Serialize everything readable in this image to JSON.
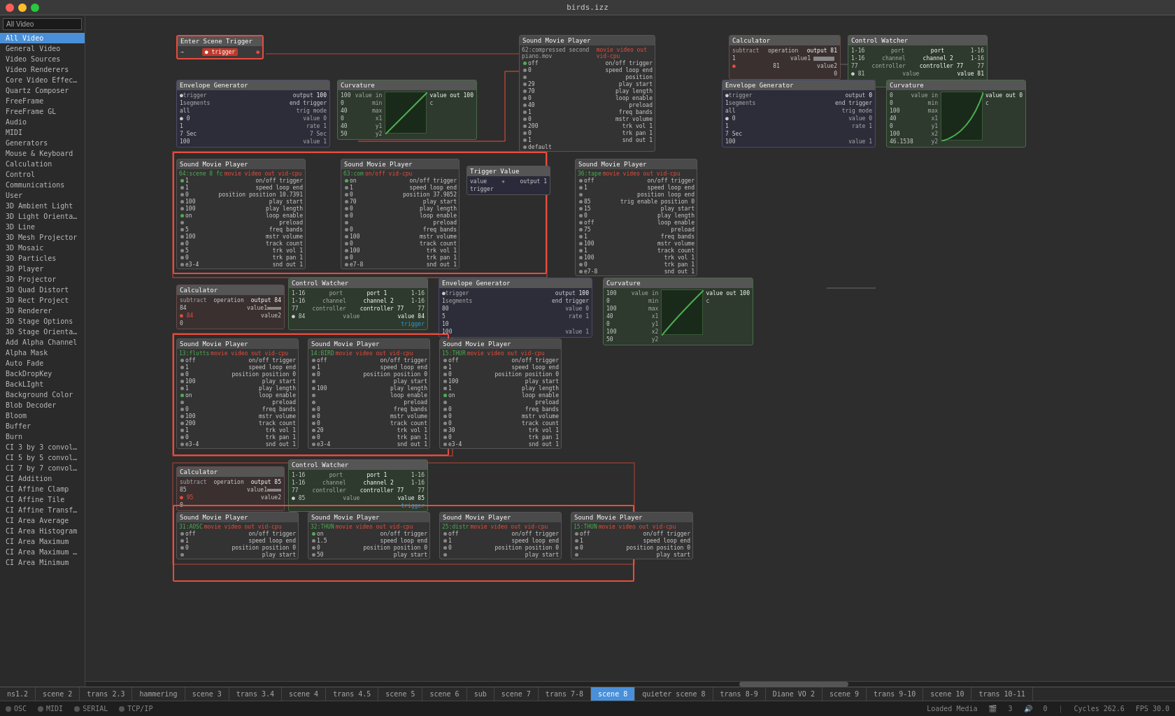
{
  "titlebar": {
    "title": "birds.izz"
  },
  "sidebar": {
    "search_placeholder": "All Video",
    "items": [
      {
        "label": "All Video",
        "selected": true
      },
      {
        "label": "General Video",
        "selected": false
      },
      {
        "label": "Video Sources",
        "selected": false
      },
      {
        "label": "Video Renderers",
        "selected": false
      },
      {
        "label": "Core Video Effects",
        "selected": false
      },
      {
        "label": "Quartz Composer",
        "selected": false
      },
      {
        "label": "FreeFrame",
        "selected": false
      },
      {
        "label": "FreeFrame GL",
        "selected": false
      },
      {
        "label": "Audio",
        "selected": false
      },
      {
        "label": "MIDI",
        "selected": false
      },
      {
        "label": "Generators",
        "selected": false
      },
      {
        "label": "Mouse & Keyboard",
        "selected": false
      },
      {
        "label": "Calculation",
        "selected": false
      },
      {
        "label": "Control",
        "selected": false
      },
      {
        "label": "Communications",
        "selected": false
      },
      {
        "label": "User",
        "selected": false
      },
      {
        "label": "3D Ambient Light",
        "selected": false
      },
      {
        "label": "3D Light Orientation",
        "selected": false
      },
      {
        "label": "3D Line",
        "selected": false
      },
      {
        "label": "3D Mesh Projector",
        "selected": false
      },
      {
        "label": "3D Mosaic",
        "selected": false
      },
      {
        "label": "3D Particles",
        "selected": false
      },
      {
        "label": "3D Player",
        "selected": false
      },
      {
        "label": "3D Projector",
        "selected": false
      },
      {
        "label": "3D Quad Distort",
        "selected": false
      },
      {
        "label": "3D Rect Project",
        "selected": false
      },
      {
        "label": "3D Renderer",
        "selected": false
      },
      {
        "label": "3D Stage Options",
        "selected": false
      },
      {
        "label": "3D Stage Orientation",
        "selected": false
      },
      {
        "label": "Add Alpha Channel",
        "selected": false
      },
      {
        "label": "Alpha Mask",
        "selected": false
      },
      {
        "label": "Auto Fade",
        "selected": false
      },
      {
        "label": "BackDropKey",
        "selected": false
      },
      {
        "label": "BackLight",
        "selected": false
      },
      {
        "label": "Background Color",
        "selected": false
      },
      {
        "label": "Blob Decoder",
        "selected": false
      },
      {
        "label": "Bloom",
        "selected": false
      },
      {
        "label": "Buffer",
        "selected": false
      },
      {
        "label": "Burn",
        "selected": false
      },
      {
        "label": "CI 3 by 3 convolution",
        "selected": false
      },
      {
        "label": "CI 5 by 5 convolution",
        "selected": false
      },
      {
        "label": "CI 7 by 7 convolution",
        "selected": false
      },
      {
        "label": "CI Addition",
        "selected": false
      },
      {
        "label": "CI Affine Clamp",
        "selected": false
      },
      {
        "label": "CI Affine Tile",
        "selected": false
      },
      {
        "label": "CI Affine Transform",
        "selected": false
      },
      {
        "label": "CI Area Average",
        "selected": false
      },
      {
        "label": "CI Area Histogram",
        "selected": false
      },
      {
        "label": "CI Area Maximum",
        "selected": false
      },
      {
        "label": "CI Area Maximum Alp...",
        "selected": false
      },
      {
        "label": "CI Area Minimum",
        "selected": false
      }
    ]
  },
  "tabs": [
    {
      "label": "ns1.2",
      "active": false
    },
    {
      "label": "scene 2",
      "active": false
    },
    {
      "label": "trans 2.3",
      "active": false
    },
    {
      "label": "hammering",
      "active": false
    },
    {
      "label": "scene 3",
      "active": false
    },
    {
      "label": "trans 3.4",
      "active": false
    },
    {
      "label": "scene 4",
      "active": false
    },
    {
      "label": "trans 4.5",
      "active": false
    },
    {
      "label": "scene 5",
      "active": false
    },
    {
      "label": "scene 6",
      "active": false
    },
    {
      "label": "sub",
      "active": false
    },
    {
      "label": "scene 7",
      "active": false
    },
    {
      "label": "trans 7-8",
      "active": false
    },
    {
      "label": "scene 8",
      "active": true
    },
    {
      "label": "quieter scene 8",
      "active": false
    },
    {
      "label": "trans 8-9",
      "active": false
    },
    {
      "label": "Diane VO 2",
      "active": false
    },
    {
      "label": "scene 9",
      "active": false
    },
    {
      "label": "trans 9-10",
      "active": false
    },
    {
      "label": "scene 10",
      "active": false
    },
    {
      "label": "trans 10-11",
      "active": false
    }
  ],
  "statusbar": {
    "osc": "OSC",
    "midi": "MIDI",
    "serial": "SERIAL",
    "tcpip": "TCP/IP",
    "loaded_media": "Loaded Media",
    "media_count": "3",
    "audio_count": "0",
    "cycles": "Cycles 262.6",
    "fps": "FPS 30.0"
  },
  "nodes": {
    "enter_scene_trigger": {
      "title": "Enter Scene Trigger",
      "trigger_label": "trigger"
    },
    "sound_movie_player_top": {
      "title": "Sound Movie Player",
      "file": "62:compressed second piano.mov",
      "outputs": [
        "movie",
        "video out",
        "vid-cpu"
      ]
    },
    "calculator_top": {
      "title": "Calculator",
      "operation": "subtract",
      "output": "81"
    },
    "control_watcher_top": {
      "title": "Control Watcher",
      "port": "port",
      "channel": "2",
      "controller": "77",
      "value": "81"
    },
    "envelope_gen_top_left": {
      "title": "Envelope Generator",
      "output": "100"
    },
    "curvature_top_left": {
      "title": "Curvature",
      "value_in": "",
      "value_out": "100"
    },
    "envelope_gen_top_right": {
      "title": "Envelope Generator",
      "output": "0"
    },
    "curvature_top_right": {
      "title": "Curvature",
      "value_in": "",
      "value_out": "0"
    },
    "smp_scene8_64": {
      "title": "Sound Movie Player",
      "file": "64:scene 8 fc",
      "play_start": "",
      "play_length": ""
    },
    "smp_63": {
      "title": "Sound Movie Player",
      "file": "63:com",
      "play_start": "play start",
      "play_length": "play length"
    },
    "trigger_value": {
      "title": "Trigger Value",
      "value": "1"
    },
    "smp_36_tape": {
      "title": "Sound Movie Player",
      "file": "36:tape",
      "play_start": "play start"
    },
    "calc_mid": {
      "title": "Calculator",
      "operation": "subtract",
      "output": "84"
    },
    "control_watcher_mid": {
      "title": "Control Watcher",
      "channel": "2",
      "controller": "77",
      "value": "84"
    },
    "envelope_gen_mid": {
      "title": "Envelope Generator",
      "output": "100"
    },
    "curvature_mid": {
      "title": "Curvature",
      "value_in": "",
      "value_out": "100"
    },
    "smp_13_flutts": {
      "title": "Sound Movie Player",
      "file": "13:flutts",
      "play_start": "play start"
    },
    "smp_14_bird": {
      "title": "Sound Movie Player",
      "file": "14:BIRD",
      "play_start": "play start"
    },
    "smp_15_thur": {
      "title": "Sound Movie Player",
      "file": "15:THUR",
      "play_start": "play start"
    },
    "calc_bot": {
      "title": "Calculator",
      "operation": "subtract",
      "output": "85"
    },
    "control_watcher_bot": {
      "title": "Control Watcher",
      "channel": "2",
      "controller": "77",
      "value": "85"
    },
    "smp_31_aosc": {
      "title": "Sound Movie Player",
      "file": "31:AOSC",
      "play_start": "play start"
    },
    "smp_32_thun": {
      "title": "Sound Movie Player",
      "file": "32:THUN",
      "play_start": "play start"
    },
    "smp_25_distr": {
      "title": "Sound Movie Player",
      "file": "25:distr",
      "play_start": ""
    },
    "smp_15_thun_bot": {
      "title": "Sound Movie Player",
      "file": "15:THUN",
      "play_start": ""
    }
  }
}
